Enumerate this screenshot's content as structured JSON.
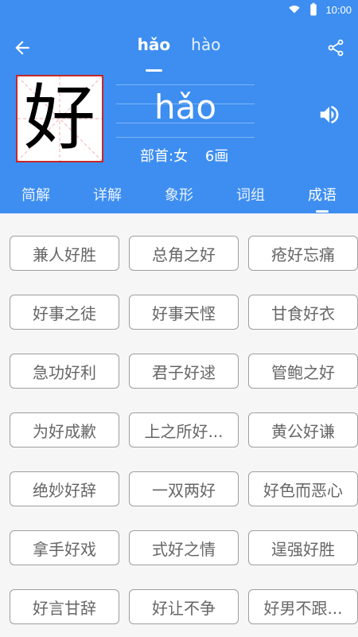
{
  "status": {
    "time": "10:00"
  },
  "header": {
    "pinyin_tabs": [
      {
        "label": "hǎo",
        "active": true
      },
      {
        "label": "hào",
        "active": false
      }
    ],
    "character": "好",
    "pinyin_display": "hǎo",
    "radical": "部首:女",
    "strokes": "6画",
    "section_tabs": [
      {
        "label": "简解",
        "active": false
      },
      {
        "label": "详解",
        "active": false
      },
      {
        "label": "象形",
        "active": false
      },
      {
        "label": "词组",
        "active": false
      },
      {
        "label": "成语",
        "active": true
      }
    ]
  },
  "idioms": [
    "兼人好胜",
    "总角之好",
    "疮好忘痛",
    "好事之徒",
    "好事天悭",
    "甘食好衣",
    "急功好利",
    "君子好逑",
    "管鲍之好",
    "为好成歉",
    "上之所好...",
    "黄公好谦",
    "绝妙好辞",
    "一双两好",
    "好色而恶心",
    "拿手好戏",
    "式好之情",
    "逞强好胜",
    "好言甘辞",
    "好让不争",
    "好男不跟..."
  ],
  "colors": {
    "primary": "#3d8ef0",
    "chip_border": "#9e9e9e",
    "char_border": "#c62828"
  }
}
